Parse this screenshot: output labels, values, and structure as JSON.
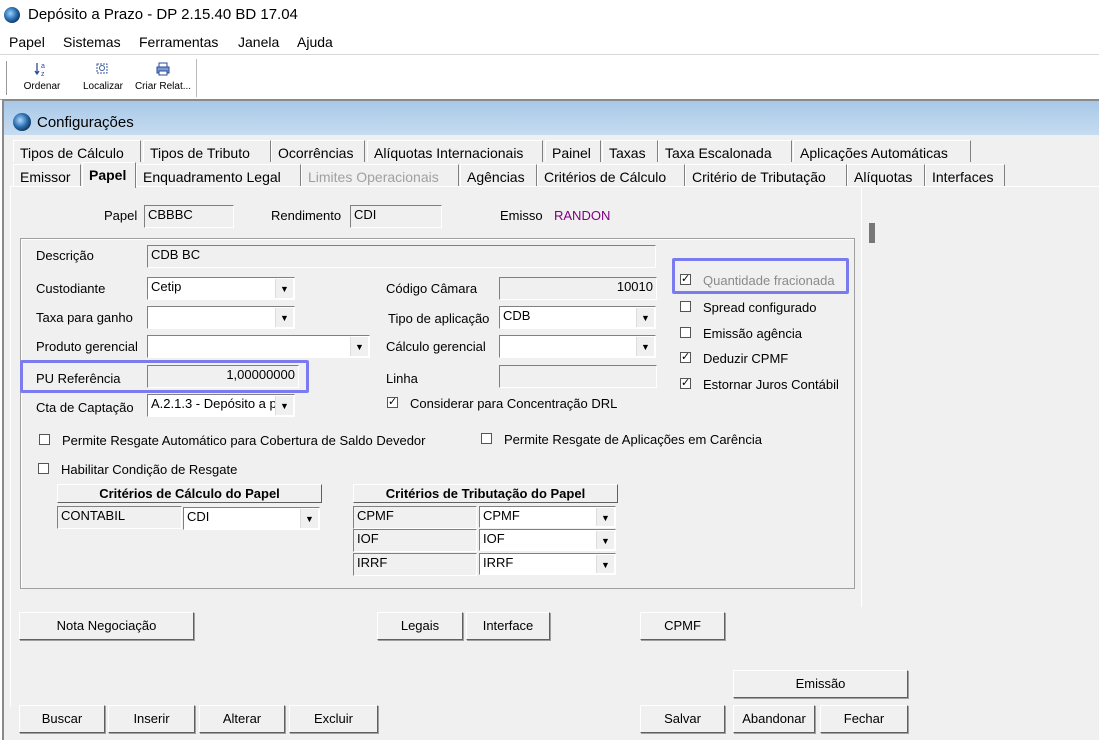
{
  "app": {
    "title": "Depósito a Prazo -  DP 2.15.40 BD 17.04"
  },
  "menu": [
    "Papel",
    "Sistemas",
    "Ferramentas",
    "Janela",
    "Ajuda"
  ],
  "toolbar": {
    "buttons": [
      {
        "label": "Ordenar",
        "icon": "sort-az-icon"
      },
      {
        "label": "Localizar",
        "icon": "find-icon"
      },
      {
        "label": "Criar Relat...",
        "icon": "printer-icon"
      }
    ]
  },
  "window": {
    "title": "Configurações"
  },
  "tabs_row1": [
    "Tipos de Cálculo",
    "Tipos de Tributo",
    "Ocorrências",
    "Alíquotas Internacionais",
    "Painel",
    "Taxas",
    "Taxa Escalonada",
    "Aplicações Automáticas"
  ],
  "tabs_row2": [
    "Emissor",
    "Papel",
    "Enquadramento Legal",
    "Limites Operacionais",
    "Agências",
    "Critérios de Cálculo",
    "Critério de Tributação",
    "Alíquotas",
    "Interfaces"
  ],
  "header_fields": {
    "papel_label": "Papel",
    "papel_value": "CBBBC",
    "rendimento_label": "Rendimento",
    "rendimento_value": "CDI",
    "emissor_label": "Emisso",
    "emissor_value": "RANDON"
  },
  "form": {
    "descricao_label": "Descrição",
    "descricao_value": "CDB BC",
    "custodiante_label": "Custodiante",
    "custodiante_value": "Cetip",
    "taxa_label": "Taxa para ganho",
    "taxa_value": "",
    "produto_label": "Produto gerencial",
    "produto_value": "",
    "pu_label": "PU Referência",
    "pu_value": "1,00000000",
    "cta_label": "Cta de Captação",
    "cta_value": "A.2.1.3 - Depósito a p",
    "codigo_camara_label": "Código Câmara",
    "codigo_camara_value": "10010",
    "tipo_aplicacao_label": "Tipo de aplicação",
    "tipo_aplicacao_value": "CDB",
    "calculo_gerencial_label": "Cálculo gerencial",
    "calculo_gerencial_value": "",
    "linha_label": "Linha",
    "linha_value": "",
    "considerar_drl": "Considerar para Concentração DRL",
    "permite_resgate_auto": "Permite Resgate Automático para Cobertura de Saldo Devedor",
    "permite_resgate_carencia": "Permite Resgate de Aplicações em Carência",
    "habilitar_resgate": "Habilitar Condição de Resgate"
  },
  "options": [
    {
      "label": "Quantidade fracionada",
      "checked": true,
      "disabled": true
    },
    {
      "label": "Spread configurado",
      "checked": false
    },
    {
      "label": "Emissão agência",
      "checked": false
    },
    {
      "label": "Deduzir CPMF",
      "checked": true
    },
    {
      "label": "Estornar Juros Contábil",
      "checked": true
    }
  ],
  "criterios_calculo": {
    "title": "Critérios de Cálculo do Papel",
    "name": "CONTABIL",
    "value": "CDI"
  },
  "criterios_tributacao": {
    "title": "Critérios de Tributação do Papel",
    "rows": [
      {
        "name": "CPMF",
        "value": "CPMF"
      },
      {
        "name": "IOF",
        "value": "IOF"
      },
      {
        "name": "IRRF",
        "value": "IRRF"
      }
    ]
  },
  "buttons": {
    "nota": "Nota Negociação",
    "legais": "Legais",
    "interface": "Interface",
    "cpmf": "CPMF",
    "emissao": "Emissão",
    "buscar": "Buscar",
    "inserir": "Inserir",
    "alterar": "Alterar",
    "excluir": "Excluir",
    "salvar": "Salvar",
    "abandonar": "Abandonar",
    "fechar": "Fechar"
  },
  "colors": {
    "highlight": "#7b7bf0",
    "emissor": "#800080",
    "title_gradient": "#a8c8e8"
  }
}
